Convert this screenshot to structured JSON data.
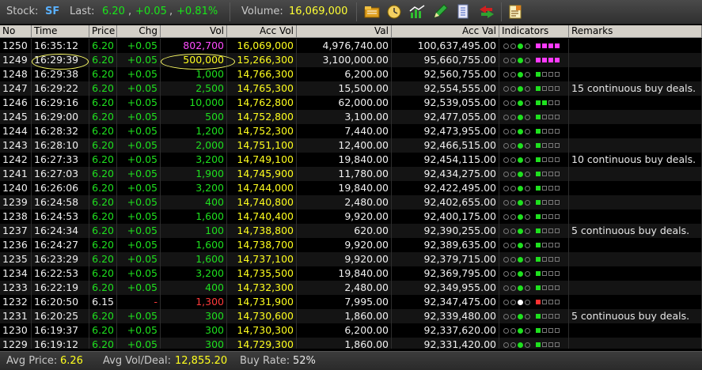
{
  "toolbar": {
    "stock_label": "Stock:",
    "stock_value": "SF",
    "last_label": "Last:",
    "last_value": "6.20",
    "change_value": "+0.05",
    "change_pct": "+0.81%",
    "volume_label": "Volume:",
    "volume_value": "16,069,000",
    "icons": [
      "folder-icon",
      "clock-icon",
      "chart-icon",
      "pencil-icon",
      "document-icon",
      "transfer-icon",
      "notes-icon"
    ]
  },
  "table": {
    "headers": [
      "No",
      "Time",
      "Price",
      "Chg",
      "Vol",
      "Acc Vol",
      "Val",
      "Acc Val",
      "Indicators",
      "Remarks"
    ],
    "rows": [
      {
        "no": "1250",
        "time": "16:35:12",
        "price": "6.20",
        "chg": "+0.05",
        "vol": "802,700",
        "accvol": "16,069,000",
        "val": "4,976,740.00",
        "accval": "100,637,495.00",
        "vol_color": "magenta",
        "ind": "m4",
        "remark": ""
      },
      {
        "no": "1249",
        "time": "16:29:39",
        "price": "6.20",
        "chg": "+0.05",
        "vol": "500,000",
        "accvol": "15,266,300",
        "val": "3,100,000.00",
        "accval": "95,660,755.00",
        "vol_color": "yellow",
        "ind": "m4",
        "remark": ""
      },
      {
        "no": "1248",
        "time": "16:29:38",
        "price": "6.20",
        "chg": "+0.05",
        "vol": "1,000",
        "accvol": "14,766,300",
        "val": "6,200.00",
        "accval": "92,560,755.00",
        "vol_color": "green",
        "ind": "g1",
        "remark": ""
      },
      {
        "no": "1247",
        "time": "16:29:22",
        "price": "6.20",
        "chg": "+0.05",
        "vol": "2,500",
        "accvol": "14,765,300",
        "val": "15,500.00",
        "accval": "92,554,555.00",
        "vol_color": "green",
        "ind": "g1",
        "remark": "15 continuous buy deals."
      },
      {
        "no": "1246",
        "time": "16:29:16",
        "price": "6.20",
        "chg": "+0.05",
        "vol": "10,000",
        "accvol": "14,762,800",
        "val": "62,000.00",
        "accval": "92,539,055.00",
        "vol_color": "green",
        "ind": "g2",
        "remark": ""
      },
      {
        "no": "1245",
        "time": "16:29:00",
        "price": "6.20",
        "chg": "+0.05",
        "vol": "500",
        "accvol": "14,752,800",
        "val": "3,100.00",
        "accval": "92,477,055.00",
        "vol_color": "green",
        "ind": "g1",
        "remark": ""
      },
      {
        "no": "1244",
        "time": "16:28:32",
        "price": "6.20",
        "chg": "+0.05",
        "vol": "1,200",
        "accvol": "14,752,300",
        "val": "7,440.00",
        "accval": "92,473,955.00",
        "vol_color": "green",
        "ind": "g1",
        "remark": ""
      },
      {
        "no": "1243",
        "time": "16:28:10",
        "price": "6.20",
        "chg": "+0.05",
        "vol": "2,000",
        "accvol": "14,751,100",
        "val": "12,400.00",
        "accval": "92,466,515.00",
        "vol_color": "green",
        "ind": "g1",
        "remark": ""
      },
      {
        "no": "1242",
        "time": "16:27:33",
        "price": "6.20",
        "chg": "+0.05",
        "vol": "3,200",
        "accvol": "14,749,100",
        "val": "19,840.00",
        "accval": "92,454,115.00",
        "vol_color": "green",
        "ind": "g1",
        "remark": "10 continuous buy deals."
      },
      {
        "no": "1241",
        "time": "16:27:03",
        "price": "6.20",
        "chg": "+0.05",
        "vol": "1,900",
        "accvol": "14,745,900",
        "val": "11,780.00",
        "accval": "92,434,275.00",
        "vol_color": "green",
        "ind": "g1",
        "remark": ""
      },
      {
        "no": "1240",
        "time": "16:26:06",
        "price": "6.20",
        "chg": "+0.05",
        "vol": "3,200",
        "accvol": "14,744,000",
        "val": "19,840.00",
        "accval": "92,422,495.00",
        "vol_color": "green",
        "ind": "g1",
        "remark": ""
      },
      {
        "no": "1239",
        "time": "16:24:58",
        "price": "6.20",
        "chg": "+0.05",
        "vol": "400",
        "accvol": "14,740,800",
        "val": "2,480.00",
        "accval": "92,402,655.00",
        "vol_color": "green",
        "ind": "g1",
        "remark": ""
      },
      {
        "no": "1238",
        "time": "16:24:53",
        "price": "6.20",
        "chg": "+0.05",
        "vol": "1,600",
        "accvol": "14,740,400",
        "val": "9,920.00",
        "accval": "92,400,175.00",
        "vol_color": "green",
        "ind": "g1",
        "remark": ""
      },
      {
        "no": "1237",
        "time": "16:24:34",
        "price": "6.20",
        "chg": "+0.05",
        "vol": "100",
        "accvol": "14,738,800",
        "val": "620.00",
        "accval": "92,390,255.00",
        "vol_color": "green",
        "ind": "g1",
        "remark": "5 continuous buy deals."
      },
      {
        "no": "1236",
        "time": "16:24:27",
        "price": "6.20",
        "chg": "+0.05",
        "vol": "1,600",
        "accvol": "14,738,700",
        "val": "9,920.00",
        "accval": "92,389,635.00",
        "vol_color": "green",
        "ind": "g1",
        "remark": ""
      },
      {
        "no": "1235",
        "time": "16:23:29",
        "price": "6.20",
        "chg": "+0.05",
        "vol": "1,600",
        "accvol": "14,737,100",
        "val": "9,920.00",
        "accval": "92,379,715.00",
        "vol_color": "green",
        "ind": "g1",
        "remark": ""
      },
      {
        "no": "1234",
        "time": "16:22:53",
        "price": "6.20",
        "chg": "+0.05",
        "vol": "3,200",
        "accvol": "14,735,500",
        "val": "19,840.00",
        "accval": "92,369,795.00",
        "vol_color": "green",
        "ind": "g1",
        "remark": ""
      },
      {
        "no": "1233",
        "time": "16:22:19",
        "price": "6.20",
        "chg": "+0.05",
        "vol": "400",
        "accvol": "14,732,300",
        "val": "2,480.00",
        "accval": "92,349,955.00",
        "vol_color": "green",
        "ind": "g1",
        "remark": ""
      },
      {
        "no": "1232",
        "time": "16:20:50",
        "price": "6.15",
        "chg": "-",
        "vol": "1,300",
        "accvol": "14,731,900",
        "val": "7,995.00",
        "accval": "92,347,475.00",
        "vol_color": "red",
        "ind": "r1",
        "remark": ""
      },
      {
        "no": "1231",
        "time": "16:20:25",
        "price": "6.20",
        "chg": "+0.05",
        "vol": "300",
        "accvol": "14,730,600",
        "val": "1,860.00",
        "accval": "92,339,480.00",
        "vol_color": "green",
        "ind": "g1",
        "remark": "5 continuous buy deals."
      },
      {
        "no": "1230",
        "time": "16:19:37",
        "price": "6.20",
        "chg": "+0.05",
        "vol": "300",
        "accvol": "14,730,300",
        "val": "6,200.00",
        "accval": "92,337,620.00",
        "vol_color": "green",
        "ind": "g1",
        "remark": ""
      },
      {
        "no": "1229",
        "time": "16:19:12",
        "price": "6.20",
        "chg": "+0.05",
        "vol": "300",
        "accvol": "14,729,300",
        "val": "1,860.00",
        "accval": "92,331,420.00",
        "vol_color": "green",
        "ind": "g1",
        "remark": ""
      }
    ]
  },
  "status": {
    "avg_price_label": "Avg Price:",
    "avg_price_value": "6.26",
    "avg_vol_label": "Avg Vol/Deal:",
    "avg_vol_value": "12,855.20",
    "buy_rate_label": "Buy Rate:",
    "buy_rate_value": "52%"
  },
  "colors": {
    "green": "#1ee01e",
    "yellow": "#ffff1e",
    "magenta": "#ff4cff",
    "red": "#ff3a3a",
    "blue": "#59b0ff"
  }
}
